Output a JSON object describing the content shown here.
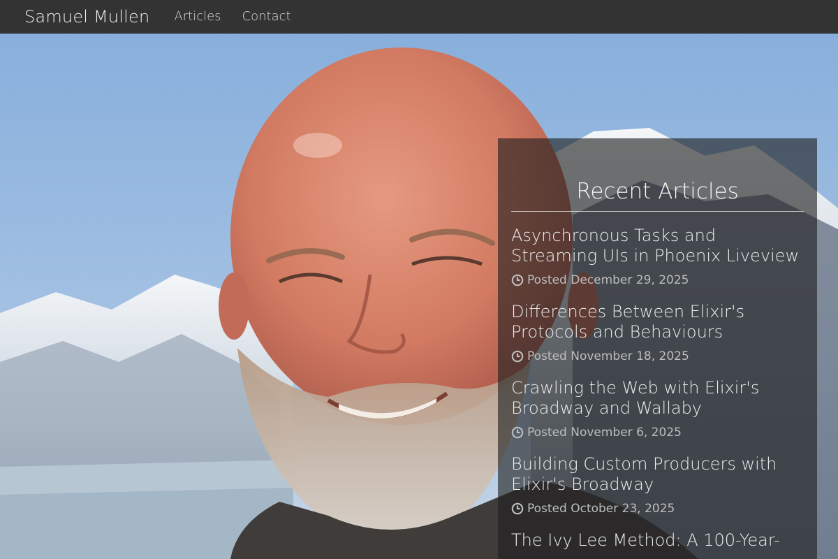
{
  "nav": {
    "brand": "Samuel Mullen",
    "links": [
      {
        "label": "Articles"
      },
      {
        "label": "Contact"
      }
    ]
  },
  "hero": {
    "image": "portrait-photo-mountains"
  },
  "recent": {
    "title": "Recent Articles",
    "articles": [
      {
        "title": "Asynchronous Tasks and Streaming UIs in Phoenix Liveview",
        "meta": "Posted December 29, 2025",
        "icon": "clock-icon"
      },
      {
        "title": "Differences Between Elixir's Protocols and Behaviours",
        "meta": "Posted November 18, 2025",
        "icon": "clock-icon"
      },
      {
        "title": "Crawling the Web with Elixir's Broadway and Wallaby",
        "meta": "Posted November 6, 2025",
        "icon": "clock-icon"
      },
      {
        "title": "Building Custom Producers with Elixir's Broadway",
        "meta": "Posted October 23, 2025",
        "icon": "clock-icon"
      },
      {
        "title": "The Ivy Lee Method: A 100-Year-",
        "meta": "",
        "icon": "clock-icon"
      }
    ]
  },
  "colors": {
    "navbar": "#333333",
    "panel": "rgba(30,30,30,0.62)",
    "sky": "#8db3df"
  }
}
